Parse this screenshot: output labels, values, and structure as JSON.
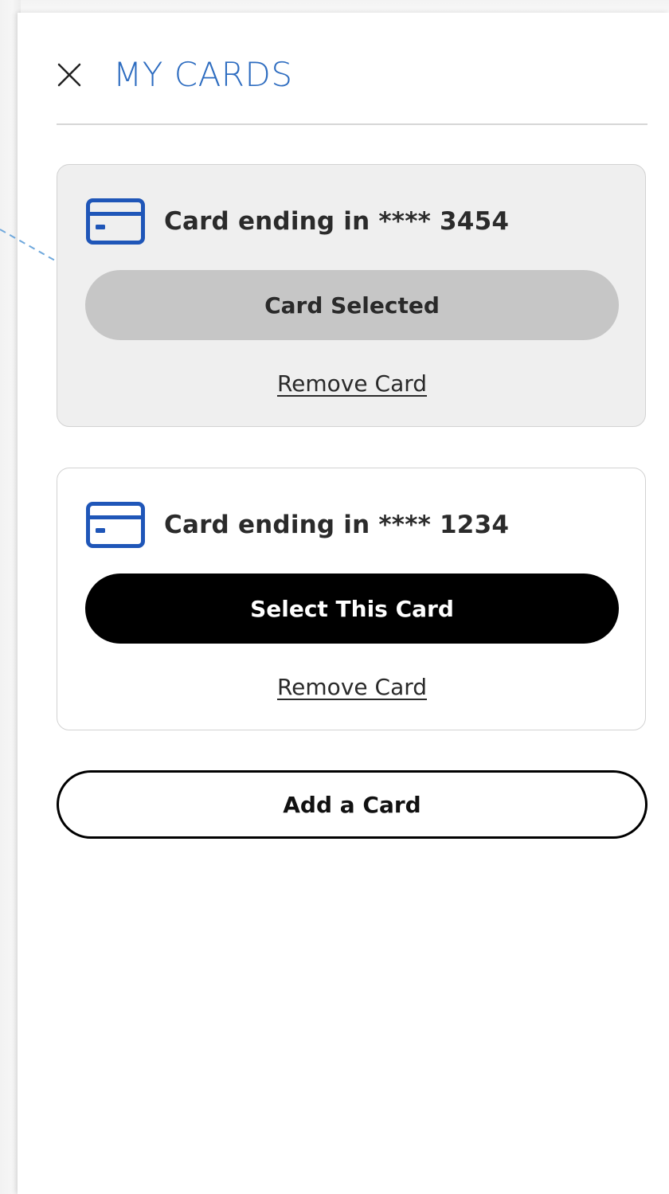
{
  "header": {
    "title": "MY CARDS",
    "close_icon": "close-icon",
    "title_color": "#2d6cc0"
  },
  "cards": [
    {
      "label": "Card ending in **** 3454",
      "icon": "credit-card-icon",
      "action_label": "Card Selected",
      "action_state": "selected",
      "remove_label": "Remove Card"
    },
    {
      "label": "Card ending in **** 1234",
      "icon": "credit-card-icon",
      "action_label": "Select This Card",
      "action_state": "available",
      "remove_label": "Remove Card"
    }
  ],
  "add_card": {
    "label": "Add a Card"
  },
  "colors": {
    "accent": "#2d6cc0",
    "card_icon": "#1f56b8",
    "selected_card_bg": "#efefef",
    "selected_button_bg": "#c6c6c6",
    "primary_button_bg": "#000000",
    "annotation_arrow": "#6fa8dc"
  }
}
